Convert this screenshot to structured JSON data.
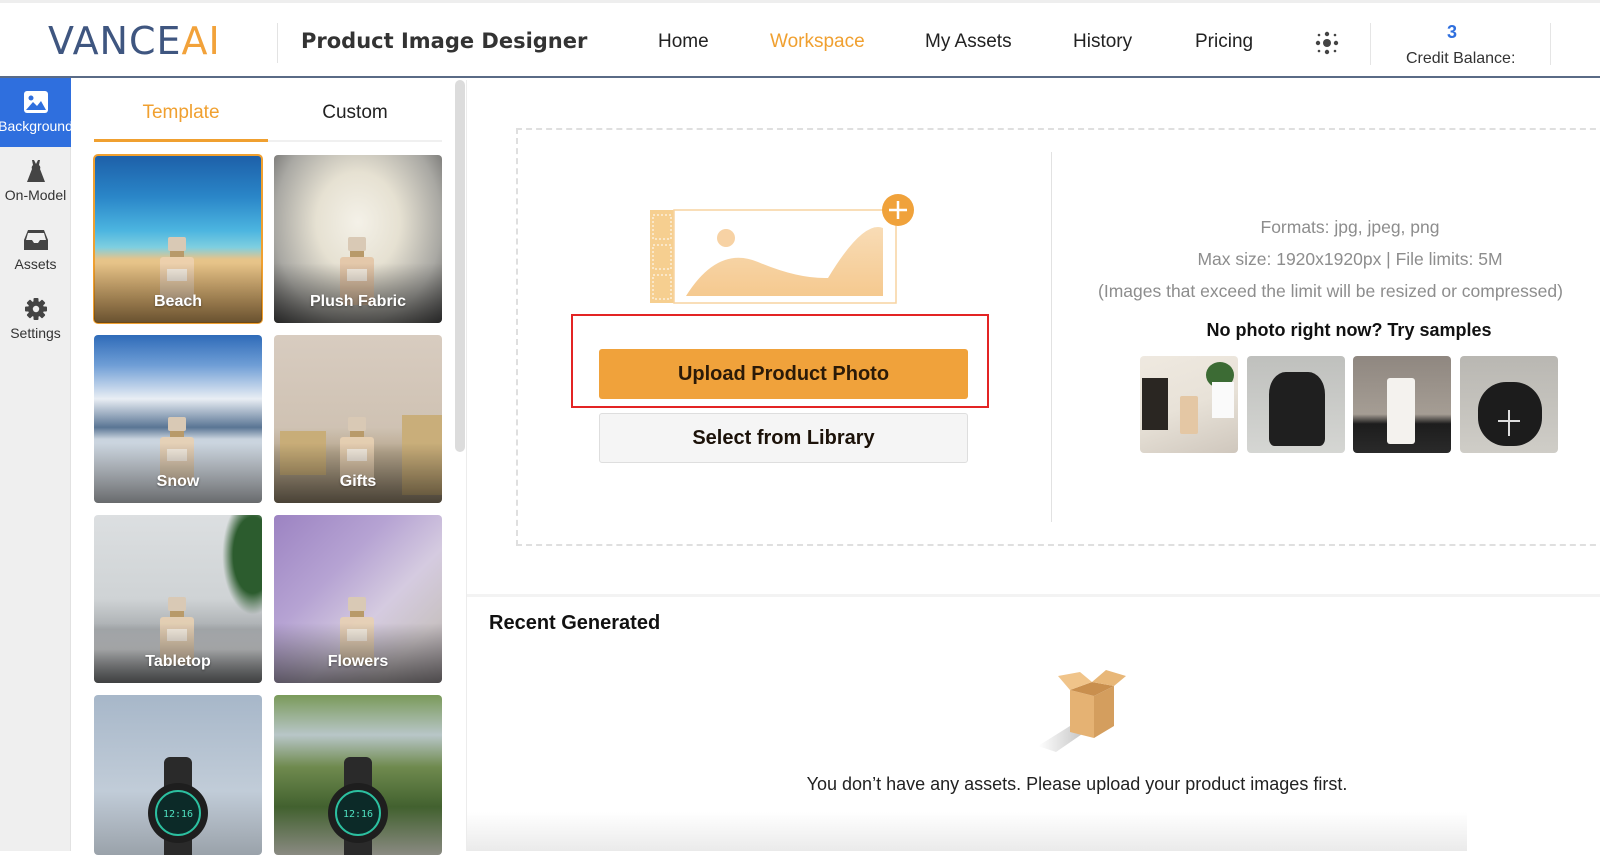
{
  "header": {
    "logo_main": "VANCE",
    "logo_accent": "AI",
    "app_title": "Product Image Designer",
    "nav": [
      {
        "label": "Home",
        "active": false
      },
      {
        "label": "Workspace",
        "active": true
      },
      {
        "label": "My Assets",
        "active": false
      },
      {
        "label": "History",
        "active": false
      },
      {
        "label": "Pricing",
        "active": false
      }
    ],
    "apps_icon": "apps-grid-icon",
    "credit_value": "3",
    "credit_label": "Credit Balance:"
  },
  "rail": {
    "items": [
      {
        "label": "Background",
        "icon": "image-icon",
        "active": true
      },
      {
        "label": "On-Model",
        "icon": "dress-icon",
        "active": false
      },
      {
        "label": "Assets",
        "icon": "inbox-icon",
        "active": false
      },
      {
        "label": "Settings",
        "icon": "gear-icon",
        "active": false
      }
    ]
  },
  "panel": {
    "tabs": [
      {
        "label": "Template",
        "active": true
      },
      {
        "label": "Custom",
        "active": false
      }
    ],
    "templates": [
      {
        "label": "Beach",
        "selected": true
      },
      {
        "label": "Plush Fabric",
        "selected": false
      },
      {
        "label": "Snow",
        "selected": false
      },
      {
        "label": "Gifts",
        "selected": false
      },
      {
        "label": "Tabletop",
        "selected": false
      },
      {
        "label": "Flowers",
        "selected": false
      },
      {
        "label": "",
        "selected": false
      },
      {
        "label": "",
        "selected": false
      }
    ]
  },
  "upload": {
    "upload_button": "Upload Product Photo",
    "library_button": "Select from Library",
    "formats": "Formats: jpg, jpeg, png",
    "limits": "Max size: 1920x1920px | File limits: 5M",
    "note": "(Images that exceed the limit will be resized or compressed)",
    "samples_title": "No photo right now? Try samples",
    "samples": [
      "Perfume sample",
      "Backpack sample",
      "Tumbler sample",
      "Speaker sample"
    ]
  },
  "recent": {
    "title": "Recent Generated",
    "empty_message": "You don’t have any assets. Please upload your product images first."
  },
  "colors": {
    "brand_blue": "#3f5680",
    "accent_orange": "#f0a030",
    "active_blue": "#2f6fde",
    "highlight_red": "#e32424"
  }
}
